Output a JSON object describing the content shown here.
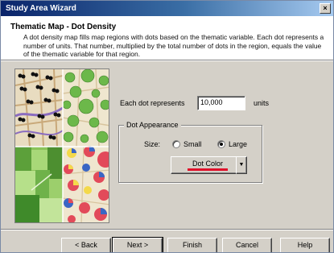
{
  "window": {
    "title": "Study Area Wizard",
    "close_glyph": "×"
  },
  "header": {
    "title": "Thematic Map - Dot Density",
    "description": "A dot density map fills map regions with dots based on the thematic variable. Each dot represents a number of units. That number, multiplied by the total number of dots in the region, equals the value of the thematic variable for that region."
  },
  "form": {
    "each_dot_label": "Each dot represents",
    "units_value": "10,000",
    "units_suffix": "units",
    "appearance_legend": "Dot Appearance",
    "size_label": "Size:",
    "size_small": "Small",
    "size_large": "Large",
    "selected_size": "Large",
    "dot_color_label": "Dot Color",
    "dot_color": "#e0102a",
    "dropdown_glyph": "▼"
  },
  "buttons": {
    "back": "< Back",
    "next": "Next >",
    "finish": "Finish",
    "cancel": "Cancel",
    "help": "Help"
  }
}
